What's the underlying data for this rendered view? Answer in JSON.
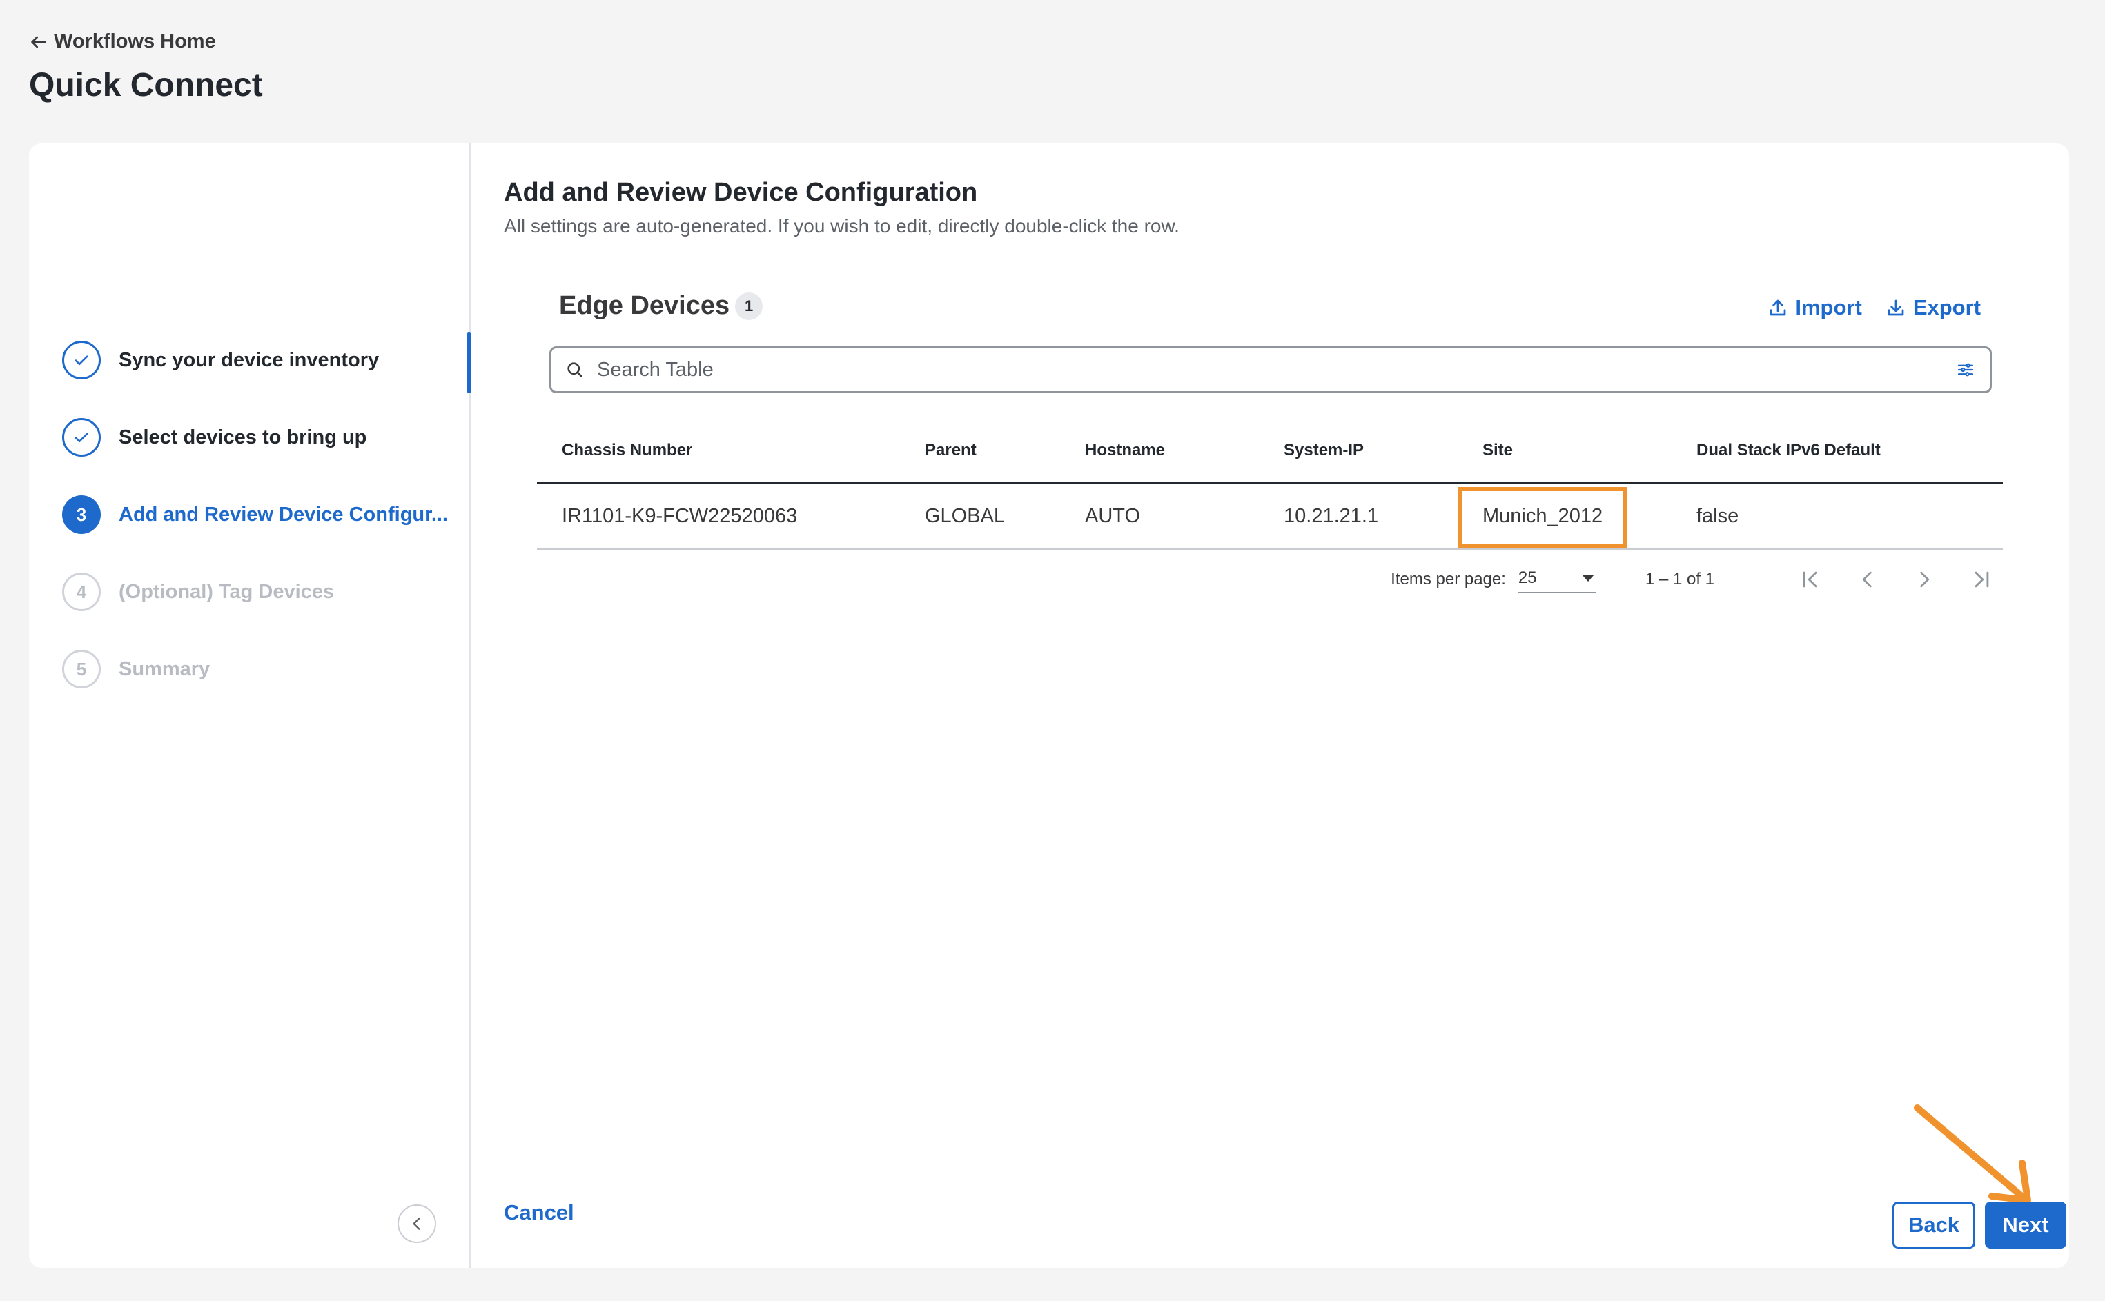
{
  "header": {
    "back_label": "Workflows Home",
    "title": "Quick Connect"
  },
  "steps": [
    {
      "number": "1",
      "label": "Sync your device inventory",
      "state": "done"
    },
    {
      "number": "2",
      "label": "Select devices to bring up",
      "state": "done"
    },
    {
      "number": "3",
      "label": "Add and Review Device Configur...",
      "state": "active"
    },
    {
      "number": "4",
      "label": "(Optional) Tag Devices",
      "state": "pending"
    },
    {
      "number": "5",
      "label": "Summary",
      "state": "pending"
    }
  ],
  "main": {
    "title": "Add and Review Device Configuration",
    "subtitle": "All settings are auto-generated. If you wish to edit, directly double-click the row."
  },
  "table": {
    "title": "Edge Devices",
    "count": "1",
    "import_label": "Import",
    "export_label": "Export",
    "search_placeholder": "Search Table",
    "columns": [
      "Chassis Number",
      "Parent",
      "Hostname",
      "System-IP",
      "Site",
      "Dual Stack IPv6 Default"
    ],
    "rows": [
      [
        "IR1101-K9-FCW22520063",
        "GLOBAL",
        "AUTO",
        "10.21.21.1",
        "Munich_2012",
        "false"
      ]
    ]
  },
  "pagination": {
    "items_per_page_label": "Items per page:",
    "items_per_page_value": "25",
    "range": "1 – 1 of 1"
  },
  "footer": {
    "cancel_label": "Cancel",
    "back_label": "Back",
    "next_label": "Next"
  },
  "colors": {
    "primary": "#1d69cc",
    "annotation": "#f0932f"
  }
}
